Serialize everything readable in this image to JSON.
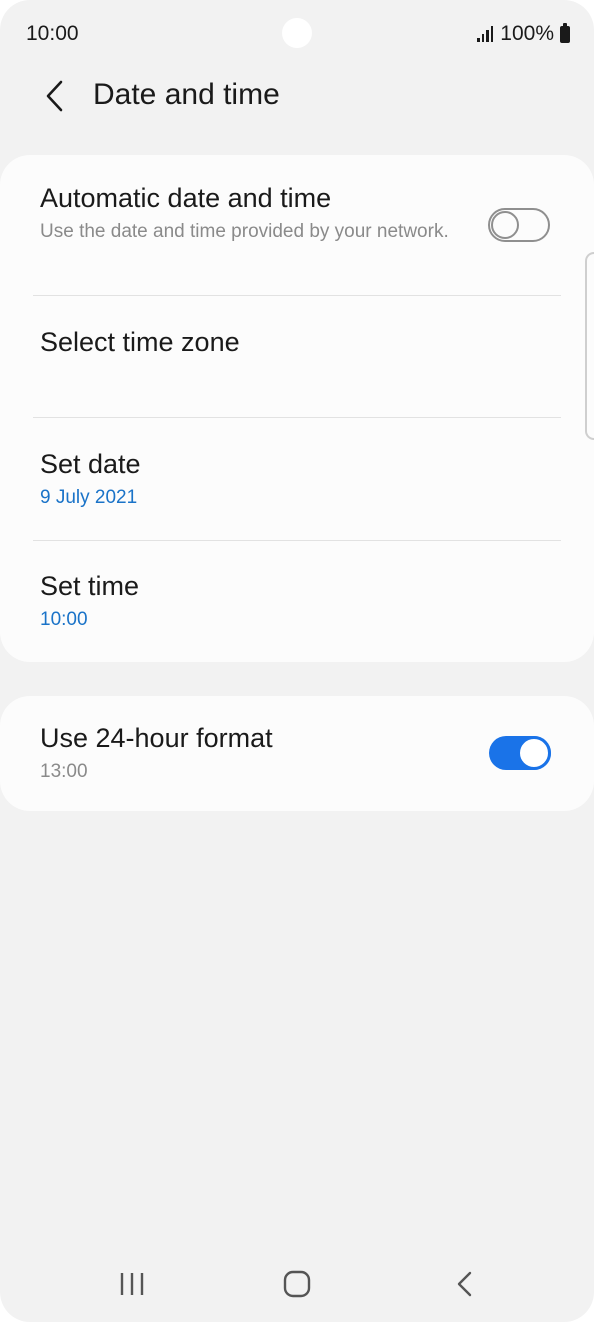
{
  "status_bar": {
    "time": "10:00",
    "battery": "100%"
  },
  "header": {
    "title": "Date and time",
    "back_icon": "chevron-left-icon"
  },
  "settings": [
    {
      "title": "Automatic date and time",
      "subtitle": "Use the date and time provided by your network.",
      "toggle": "off"
    },
    {
      "title": "Select time zone"
    },
    {
      "title": "Set date",
      "value": "9 July 2021"
    },
    {
      "title": "Set time",
      "value": "10:00"
    }
  ],
  "format_setting": {
    "title": "Use 24-hour format",
    "subtitle": "13:00",
    "toggle": "on"
  },
  "colors": {
    "accent": "#1a73e8",
    "value_text": "#1a73c8",
    "background": "#f2f2f2",
    "card": "#fcfcfc"
  },
  "nav_bar": {
    "recents_icon": "recents-icon",
    "home_icon": "home-icon",
    "back_icon": "back-icon"
  }
}
